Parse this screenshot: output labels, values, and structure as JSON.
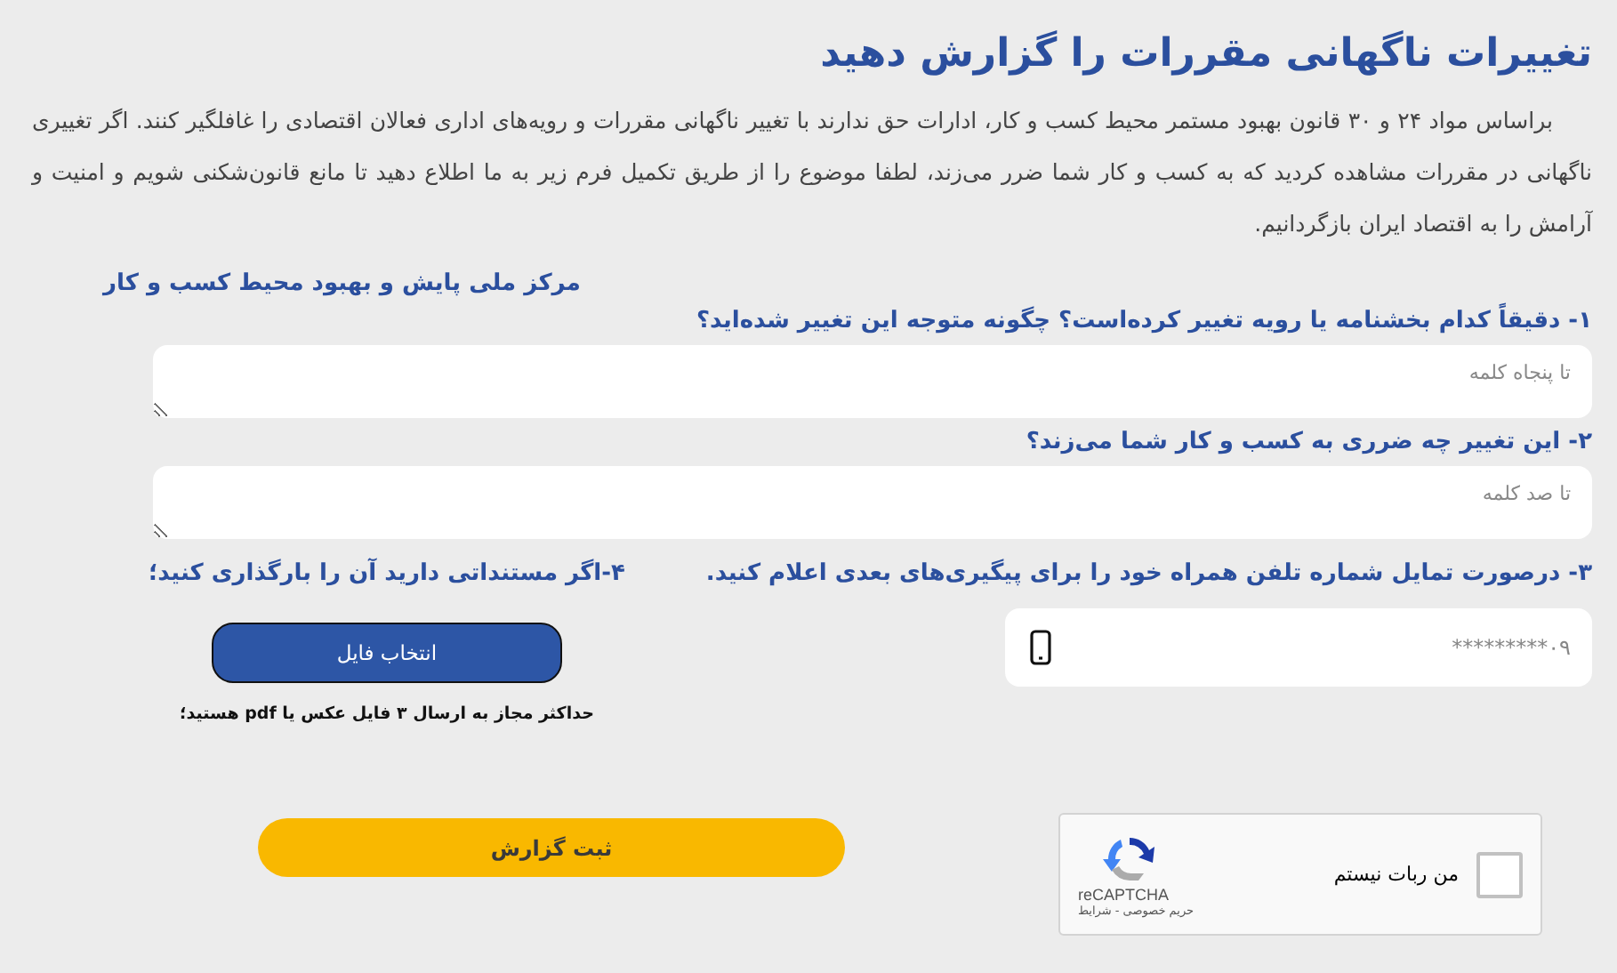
{
  "title": "تغییرات ناگهانی مقررات را گزارش دهید",
  "intro": "براساس مواد ۲۴ و ۳۰ قانون بهبود مستمر محیط کسب و کار، ادارات حق ندارند با تغییر ناگهانی مقررات و رویه‌های اداری فعالان اقتصادی را غافلگیر کنند. اگر تغییری ناگهانی در مقررات مشاهده کردید که به کسب و کار شما ضرر می‌زند، لطفا موضوع را از طریق تکمیل فرم زیر به ما اطلاع دهید تا مانع قانون‌شکنی شویم و امنیت و آرامش را به اقتصاد ایران بازگردانیم.",
  "org_name": "مرکز ملی پایش و بهبود محیط کسب و کار",
  "questions": [
    {
      "label": "۱- دقیقاً کدام بخشنامه یا رویه تغییر کرده‌است؟ چگونه متوجه این تغییر شده‌اید؟",
      "placeholder": "تا پنجاه کلمه"
    },
    {
      "label": "۲- این تغییر چه ضرری به کسب و کار شما می‌زند؟",
      "placeholder": "تا صد کلمه"
    }
  ],
  "phone": {
    "label": "۳- درصورت تمایل شماره تلفن همراه خود را برای پیگیری‌های بعدی اعلام کنید.",
    "placeholder": "۰۹*********"
  },
  "upload": {
    "label": "۴-اگر مستنداتی دارید آن را بارگذاری کنید؛",
    "button": "انتخاب فایل",
    "note": "حداکثر مجاز به ارسال ۳ فایل عکس یا pdf هستید؛"
  },
  "captcha": {
    "label": "من ربات نیستم",
    "checked": false,
    "brand": "reCAPTCHA",
    "links": "حریم خصوصی - شرایط"
  },
  "submit": "ثبت گزارش"
}
